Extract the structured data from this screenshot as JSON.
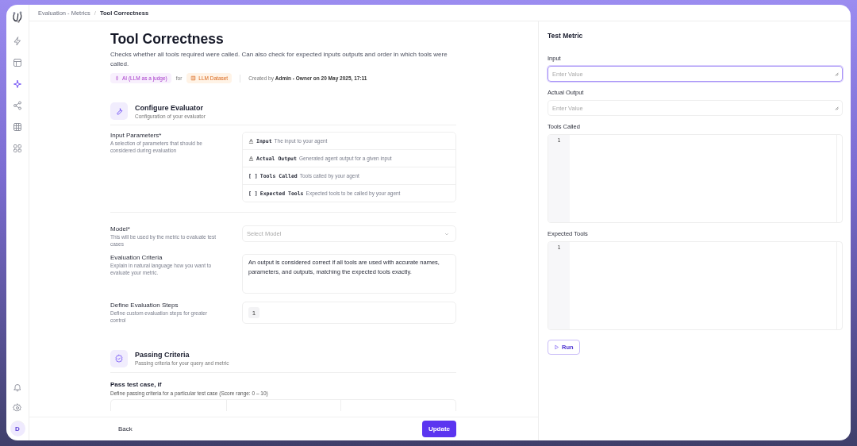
{
  "sidebar": {
    "items": [
      {
        "selected": false
      },
      {
        "selected": false
      },
      {
        "selected": true
      },
      {
        "selected": false
      },
      {
        "selected": false
      },
      {
        "selected": false
      }
    ],
    "avatar": "D"
  },
  "breadcrumb": [
    "Evaluation - Metrics",
    "Tool Correctness"
  ],
  "breadcrumb_separator": "/",
  "title": "Tool Correctness",
  "description": "Checks whether all tools required were called. Can also check for expected inputs outputs and order in which tools were called.",
  "meta": {
    "type_tag": "AI (LLM as a judge)",
    "for": "for",
    "dataset_tag": "LLM Dataset",
    "created": "Created by **Admin - Owner on 20 May 2025, 17:11**"
  },
  "configure": {
    "title": "Configure Evaluator",
    "subtitle": "Configuration of your evaluator"
  },
  "input_parameters": {
    "label": "Input Parameters*",
    "help": "A selection of parameters that should be considered during evaluation",
    "params": [
      {
        "kind": "text",
        "name": "Input",
        "desc": "The input to your agent"
      },
      {
        "kind": "text",
        "name": "Actual Output",
        "desc": "Generated agent output for a given input"
      },
      {
        "kind": "list",
        "symbol": "[ ]",
        "name": "Tools Called",
        "desc": "Tools called by your agent"
      },
      {
        "kind": "list",
        "symbol": "[ ]",
        "name": "Expected Tools",
        "desc": "Expected tools to be called by your agent"
      }
    ]
  },
  "model": {
    "label": "Model*",
    "help": "This will be used by the metric to evaluate test cases",
    "placeholder": "Select Model"
  },
  "criteria": {
    "label": "Evaluation Criteria",
    "help": "Explain in natural language how you want to evaluate your metric.",
    "value": "An output is considered correct if all tools are used with accurate names, parameters, and outputs, matching the expected tools exactly."
  },
  "steps": {
    "label": "Define Evaluation Steps",
    "help": "Define custom evaluation steps for greater control",
    "step_number": "1"
  },
  "passing": {
    "title": "Passing Criteria",
    "subtitle": "Passing criteria for your query and metric",
    "rule_title": "Pass test case, if",
    "rule_help": "Define passing criteria for a particular test case (Score range: 0 – 10)"
  },
  "footer": {
    "back": "Back",
    "update": "Update"
  },
  "test_panel": {
    "title": "Test Metric",
    "fields": [
      {
        "kind": "text",
        "label": "Input",
        "placeholder": "Enter Value",
        "focused": true
      },
      {
        "kind": "text",
        "label": "Actual Output",
        "placeholder": "Enter Value",
        "focused": false
      },
      {
        "kind": "code",
        "label": "Tools Called",
        "line": "1"
      },
      {
        "kind": "code",
        "label": "Expected Tools",
        "line": "1"
      }
    ],
    "run": "Run"
  }
}
